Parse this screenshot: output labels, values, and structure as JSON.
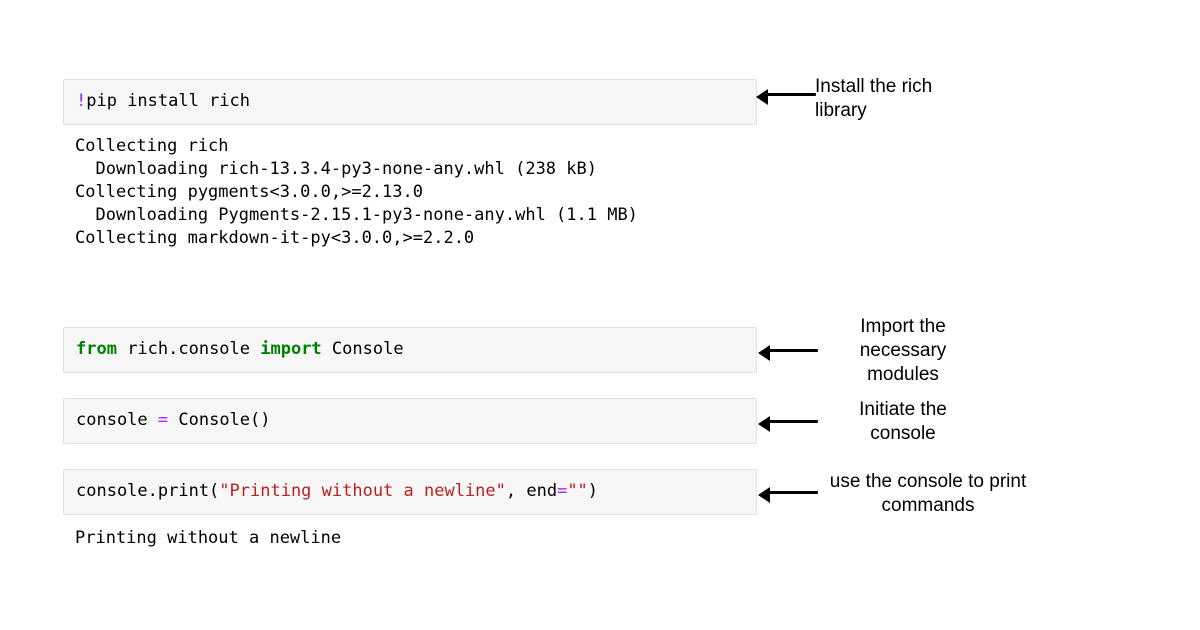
{
  "cells": {
    "install": {
      "code_tokens": [
        {
          "t": "!",
          "c": "op"
        },
        {
          "t": "pip install rich",
          "c": null
        }
      ],
      "output_lines": [
        "Collecting rich",
        "  Downloading rich-13.3.4-py3-none-any.whl (238 kB)",
        "Collecting pygments<3.0.0,>=2.13.0",
        "  Downloading Pygments-2.15.1-py3-none-any.whl (1.1 MB)",
        "Collecting markdown-it-py<3.0.0,>=2.2.0"
      ]
    },
    "import": {
      "code_tokens": [
        {
          "t": "from",
          "c": "kw"
        },
        {
          "t": " rich.console ",
          "c": null
        },
        {
          "t": "import",
          "c": "kw"
        },
        {
          "t": " Console",
          "c": null
        }
      ]
    },
    "instantiate": {
      "code_tokens": [
        {
          "t": "console ",
          "c": null
        },
        {
          "t": "=",
          "c": "op"
        },
        {
          "t": " Console()",
          "c": null
        }
      ]
    },
    "print": {
      "code_tokens": [
        {
          "t": "console.print(",
          "c": null
        },
        {
          "t": "\"Printing without a newline\"",
          "c": "str"
        },
        {
          "t": ", end",
          "c": null
        },
        {
          "t": "=",
          "c": "op"
        },
        {
          "t": "\"\"",
          "c": "str"
        },
        {
          "t": ")",
          "c": null
        }
      ],
      "output_lines": [
        "Printing without a newline"
      ]
    }
  },
  "annotations": {
    "install": "Install the rich\nlibrary",
    "import": "Import the\nnecessary\nmodules",
    "instantiate": "Initiate the\nconsole",
    "print": "use the console to\nprint commands"
  }
}
